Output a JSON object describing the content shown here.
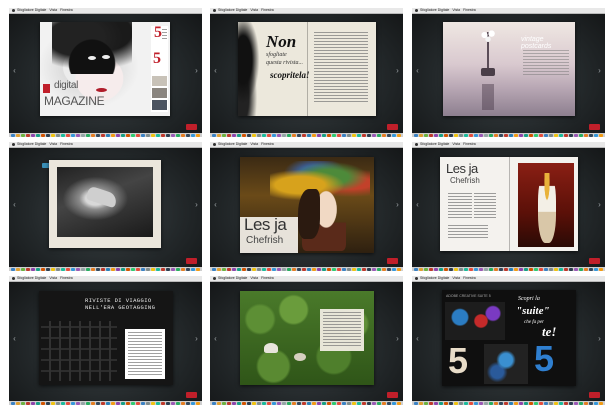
{
  "menubar": {
    "app_name": "Sfogliatore Digitale",
    "menus": [
      "Vista",
      "Finestra",
      "Aiuto"
    ]
  },
  "thumbnails": [
    {
      "id": 1,
      "texts": {
        "brand_small": "digital",
        "brand_big": "MAGAZINE",
        "num_a": "5",
        "num_b": "5"
      }
    },
    {
      "id": 2,
      "texts": {
        "line1": "Non",
        "line2": "sfogliate",
        "line3": "questa rivista...",
        "line4": "scopritela!"
      }
    },
    {
      "id": 3,
      "texts": {
        "title": "vintage postcards"
      }
    },
    {
      "id": 4,
      "texts": {}
    },
    {
      "id": 5,
      "texts": {
        "title_a": "Les ja",
        "title_b": "Chefrish"
      }
    },
    {
      "id": 6,
      "texts": {
        "title_a": "Les ja",
        "title_b": "Chefrish"
      }
    },
    {
      "id": 7,
      "texts": {
        "title_a": "RIVISTE DI VIAGGIO",
        "title_b": "NELL'ERA GEOTAGGING"
      }
    },
    {
      "id": 8,
      "texts": {}
    },
    {
      "id": 9,
      "texts": {
        "header": "ADOBE CREATIVE SUITE 5",
        "l1": "Scopri la",
        "l2": "\"suite\"",
        "l3": "che fa per",
        "l4": "te!",
        "n1": "5",
        "n2": "5"
      }
    }
  ],
  "colors": {
    "frame_bg": "#23282a",
    "accent_red": "#c01f2a",
    "menubar": "#e8e8e8"
  }
}
